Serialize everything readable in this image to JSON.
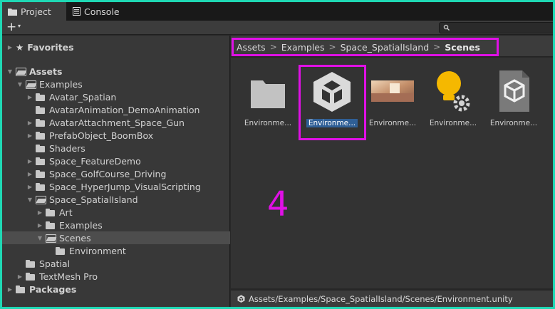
{
  "tabs": [
    {
      "label": "Project",
      "active": true
    },
    {
      "label": "Console",
      "active": false
    }
  ],
  "toolbar": {
    "add_glyph": "+",
    "add_caret_glyph": "▾",
    "search_placeholder": ""
  },
  "tree": [
    {
      "label": "Favorites",
      "bold": true,
      "depth": 0,
      "arrow": "▶",
      "icon": "star-icon",
      "glyph": "★"
    },
    {
      "label": "Assets",
      "bold": true,
      "depth": 0,
      "arrow": "▼",
      "icon": "folder-open-icon"
    },
    {
      "label": "Examples",
      "depth": 1,
      "arrow": "▼",
      "icon": "folder-open-icon"
    },
    {
      "label": "Avatar_Spatian",
      "depth": 2,
      "arrow": "▶",
      "icon": "folder-icon"
    },
    {
      "label": "AvatarAnimation_DemoAnimation",
      "depth": 2,
      "arrow": "",
      "icon": "folder-icon"
    },
    {
      "label": "AvatarAttachment_Space_Gun",
      "depth": 2,
      "arrow": "▶",
      "icon": "folder-icon"
    },
    {
      "label": "PrefabObject_BoomBox",
      "depth": 2,
      "arrow": "▶",
      "icon": "folder-icon"
    },
    {
      "label": "Shaders",
      "depth": 2,
      "arrow": "",
      "icon": "folder-icon"
    },
    {
      "label": "Space_FeatureDemo",
      "depth": 2,
      "arrow": "▶",
      "icon": "folder-icon"
    },
    {
      "label": "Space_GolfCourse_Driving",
      "depth": 2,
      "arrow": "▶",
      "icon": "folder-icon"
    },
    {
      "label": "Space_HyperJump_VisualScripting",
      "depth": 2,
      "arrow": "▶",
      "icon": "folder-icon"
    },
    {
      "label": "Space_SpatialIsland",
      "depth": 2,
      "arrow": "▼",
      "icon": "folder-open-icon"
    },
    {
      "label": "Art",
      "depth": 3,
      "arrow": "▶",
      "icon": "folder-icon"
    },
    {
      "label": "Examples",
      "depth": 3,
      "arrow": "▶",
      "icon": "folder-icon"
    },
    {
      "label": "Scenes",
      "depth": 3,
      "arrow": "▼",
      "icon": "folder-open-icon",
      "selected": true
    },
    {
      "label": "Environment",
      "depth": 4,
      "arrow": "",
      "icon": "folder-icon"
    },
    {
      "label": "Spatial",
      "depth": 1,
      "arrow": "",
      "icon": "folder-icon"
    },
    {
      "label": "TextMesh Pro",
      "depth": 1,
      "arrow": "▶",
      "icon": "folder-icon"
    },
    {
      "label": "Packages",
      "bold": true,
      "depth": 0,
      "arrow": "▶",
      "icon": "folder-icon"
    }
  ],
  "breadcrumb": {
    "items": [
      "Assets",
      "Examples",
      "Space_SpatialIsland",
      "Scenes"
    ],
    "separator": ">"
  },
  "assets": [
    {
      "label": "Environme...",
      "icon": "folder-icon",
      "selected": false
    },
    {
      "label": "Environme...",
      "icon": "unity-scene-icon",
      "selected": true
    },
    {
      "label": "Environme...",
      "icon": "environment-preview-icon",
      "selected": false
    },
    {
      "label": "Environme...",
      "icon": "lighting-settings-icon",
      "selected": false
    },
    {
      "label": "Environme...",
      "icon": "asset-file-icon",
      "selected": false
    }
  ],
  "annotation": {
    "number": "4",
    "color": "#e010e6"
  },
  "status_bar": {
    "path": "Assets/Examples/Space_SpatialIsland/Scenes/Environment.unity",
    "icon": "unity-scene-icon"
  },
  "colors": {
    "selection": "#2f5f96",
    "highlight": "#e010e6",
    "frame": "#1fd8b4"
  }
}
